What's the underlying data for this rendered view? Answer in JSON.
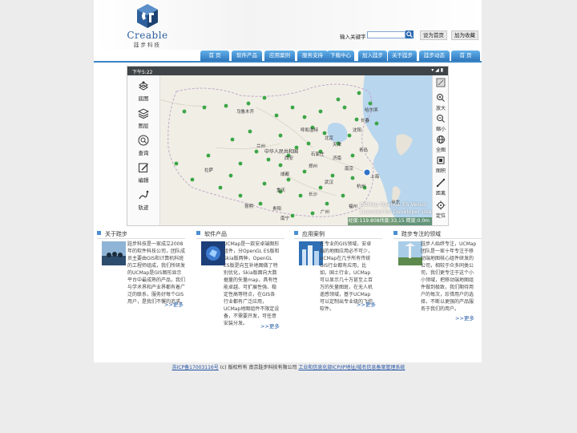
{
  "header": {
    "logo_word": "Creable",
    "logo_sub": "跬步科技",
    "search_label": "输入关键字",
    "search_value": "",
    "set_home": "设为首页",
    "add_fav": "加为收藏"
  },
  "nav": {
    "items": [
      "首 页",
      "软件产品",
      "应用案例",
      "服务支持",
      "下载中心",
      "加入跬步",
      "关于跬步",
      "跬步动态",
      "首 页"
    ]
  },
  "banner": {
    "time": "下午5:22",
    "signals": "▾ ◢ ▮",
    "left_tools": [
      "底图",
      "图层",
      "查询",
      "编辑",
      "轨迹"
    ],
    "right_tools": [
      "放大",
      "缩小",
      "全图",
      "图积",
      "距离",
      "定位"
    ],
    "watermark1": "UCMap OpenGL ES Versio",
    "watermark2": "Licensed for Developer Use",
    "coords": "经度:119.808纬度:33.15 精度:0.0m",
    "map_labels": [
      "乌鲁木齐",
      "哈尔滨",
      "长春",
      "沈阳",
      "北京",
      "天津",
      "郑州",
      "武汉",
      "南京",
      "上海",
      "杭州",
      "成都",
      "重庆",
      "长沙",
      "福州",
      "广州",
      "拉萨",
      "昆明",
      "贵阳",
      "南宁",
      "西安",
      "兰州",
      "石家庄",
      "济南",
      "青岛",
      "呼和浩特",
      "中华人民共和国",
      "台北"
    ]
  },
  "columns": [
    {
      "title": "关于跬步",
      "text": "跬步科技是一家成立2008年的软件科技公司，团队成员主要由GIS和计算机科班的工程师组成，我们所研发的UCMap是GIS图形显示平台中最成熟的产品，我们与学术界和产业界都有着广泛的联系，服务好每个GIS用户，是我们不懈的追求。",
      "more": ">>更多"
    },
    {
      "title": "软件产品",
      "text": "UCMap是一款安卓端图形组件，分OpenGL ES版和Skia版两种，OpenGL ES版是向互补地图做了特别优化，Skia版面向大数据量的矢量map，具有性能卓越、可扩展性强、稳定性高等特点，在GIS各行业都有广泛应用，UCMap地图组件不限定设备，不需要开发，可任意安装分发。",
      "more": ">>更多"
    },
    {
      "title": "应用案例",
      "text": "在专业的GIS领域，安卓端的地图应用必不可少，UCMap在几乎所有传统GIS行业都有应用，比如，国土行业，UCMap可以显示几十万甚至上百万的矢量图斑，在无人机遥感领域，基于UCMap可以定制出专业级的飞控软件。",
      "more": ">>更多"
    },
    {
      "title": "跬步专注的领域",
      "text": "跬步人始终专注，UCMap团队是一家十年专注于移动端地图核心组件研发的公司，相较于众多同类公司，我们更专注于这个小小领域，把移动端地图组件做到极致，我们期待用户的每次，珍惜用户的选择，不断以更强的产品服务于我们的用户。",
      "more": ">>更多"
    }
  ],
  "footer": {
    "icp": "苏ICP备17003116号",
    "copyright": "(c) 版权所有 南京跬步科技有限公司",
    "link": "工业和信息化部ICP/IP地址/域名信息备案管理系统"
  },
  "colors": {
    "nav_top": "#62b0ea",
    "nav_bottom": "#2f78bd",
    "link": "#2353a4",
    "map_dot": "#3ba646"
  }
}
